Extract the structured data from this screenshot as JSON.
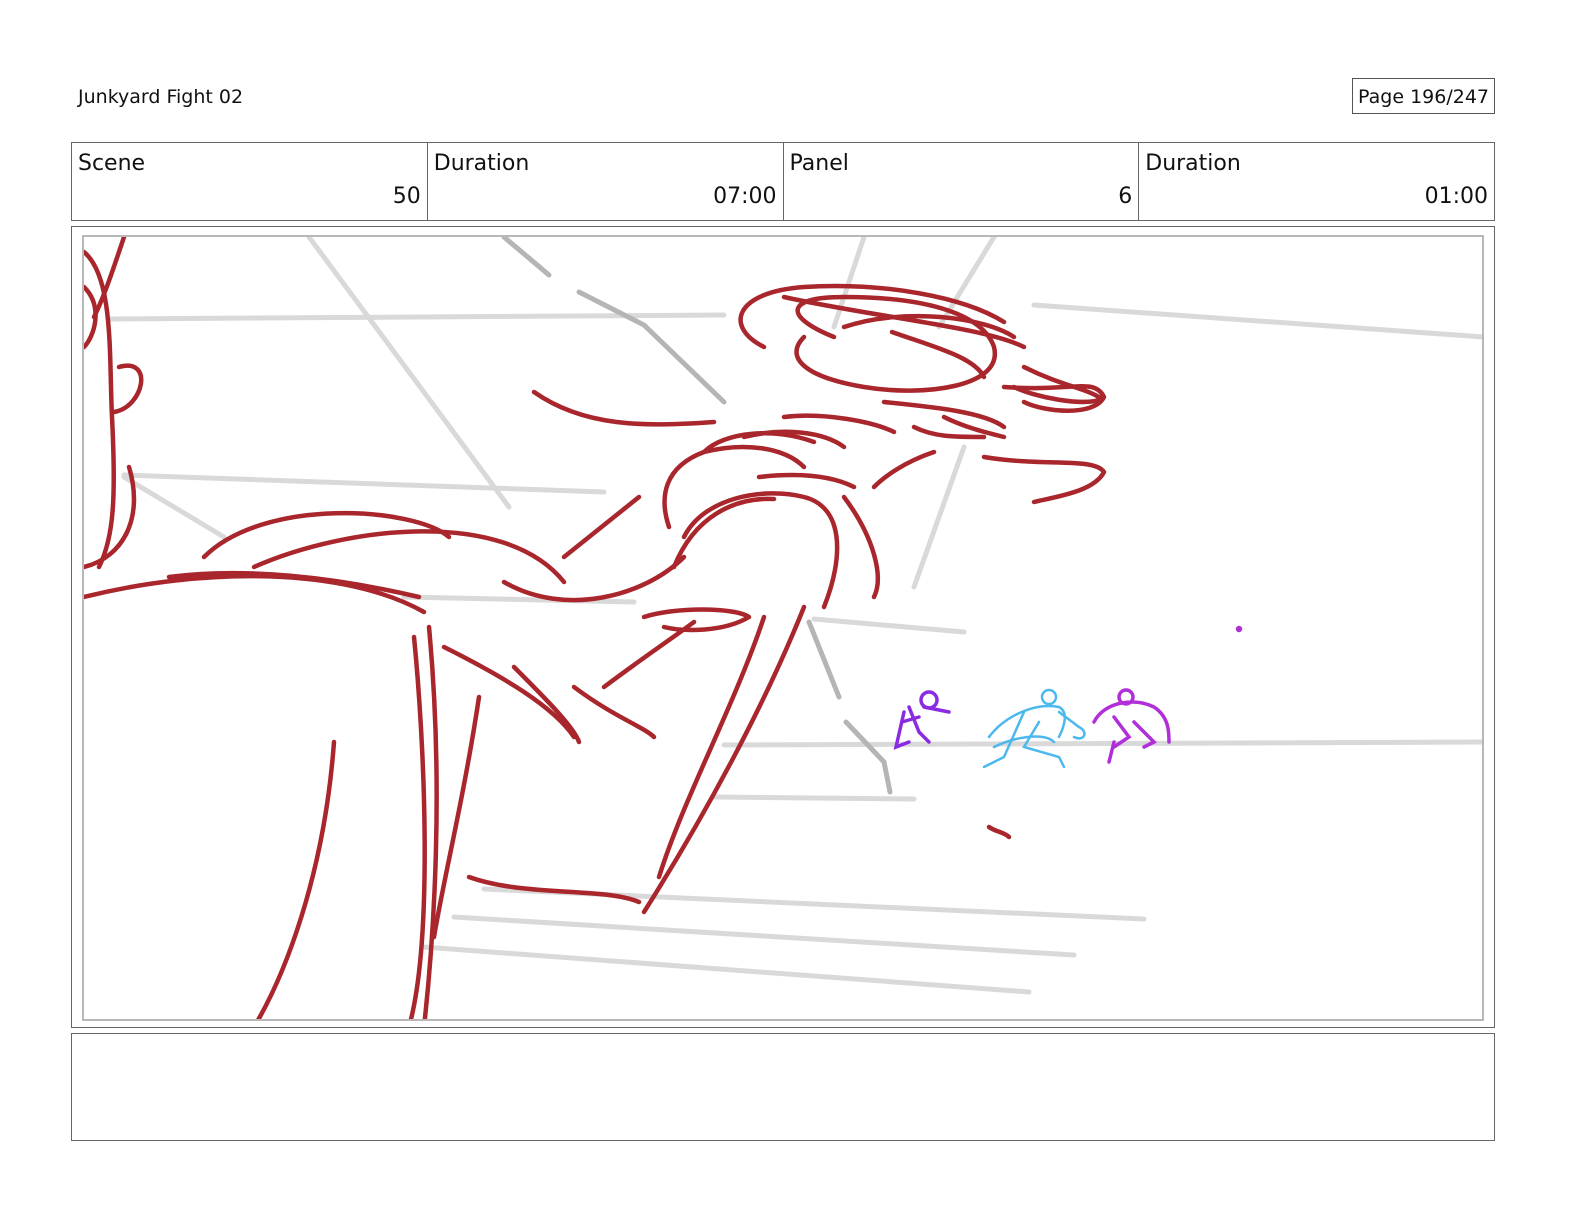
{
  "header": {
    "title": "Junkyard Fight 02",
    "page": "Page 196/247"
  },
  "info": {
    "scene_label": "Scene",
    "scene_value": "50",
    "scene_duration_label": "Duration",
    "scene_duration_value": "07:00",
    "panel_label": "Panel",
    "panel_value": "6",
    "panel_duration_label": "Duration",
    "panel_duration_value": "01:00"
  },
  "colors": {
    "foreground_sketch": "#a8262c",
    "background_sketch": "#d9d9d9",
    "figure_purple": "#8a2be2",
    "figure_blue": "#4cb8ee",
    "figure_magenta": "#b02fd8"
  },
  "notes": ""
}
